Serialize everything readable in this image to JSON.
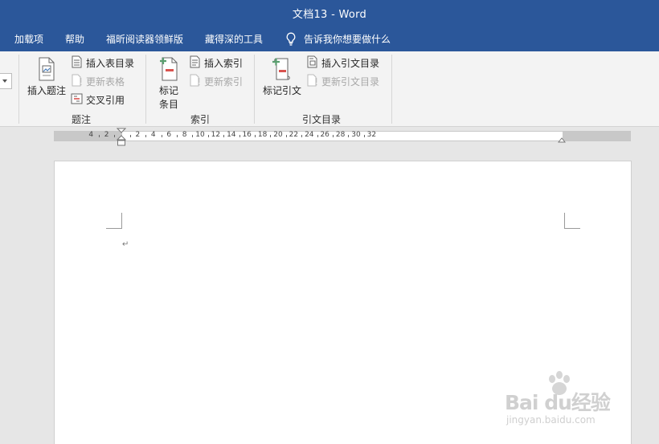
{
  "window": {
    "title": "文档13  -  Word"
  },
  "menu_tabs": [
    {
      "label": "加载项"
    },
    {
      "label": "帮助"
    },
    {
      "label": "福昕阅读器领鲜版"
    },
    {
      "label": "藏得深的工具"
    }
  ],
  "tell_me": {
    "label": "告诉我你想要做什么",
    "icon": "lightbulb-icon"
  },
  "ribbon": {
    "groups": {
      "captions": {
        "label": "题注",
        "insert_caption": "插入题注",
        "insert_table_of_figures": "插入表目录",
        "update_table": "更新表格",
        "cross_reference": "交叉引用"
      },
      "index": {
        "label": "索引",
        "mark_entry_line1": "标记",
        "mark_entry_line2": "条目",
        "insert_index": "插入索引",
        "update_index": "更新索引"
      },
      "table_of_authorities": {
        "label": "引文目录",
        "mark_citation": "标记引文",
        "insert_toa": "插入引文目录",
        "update_toa": "更新引文目录"
      }
    }
  },
  "ruler": {
    "labels": [
      "4",
      "2",
      "2",
      "4",
      "6",
      "8",
      "10",
      "12",
      "14",
      "16",
      "18",
      "20",
      "22",
      "24",
      "26",
      "28",
      "30",
      "32"
    ]
  },
  "document": {
    "paragraph_mark": "↵"
  },
  "watermark": {
    "brand": "Bai du经验",
    "url": "jingyan.baidu.com"
  },
  "colors": {
    "title_bar": "#2b579a",
    "ribbon_bg": "#f3f3f3",
    "accent_red": "#d9534f",
    "accent_green": "#5a9e6f"
  }
}
